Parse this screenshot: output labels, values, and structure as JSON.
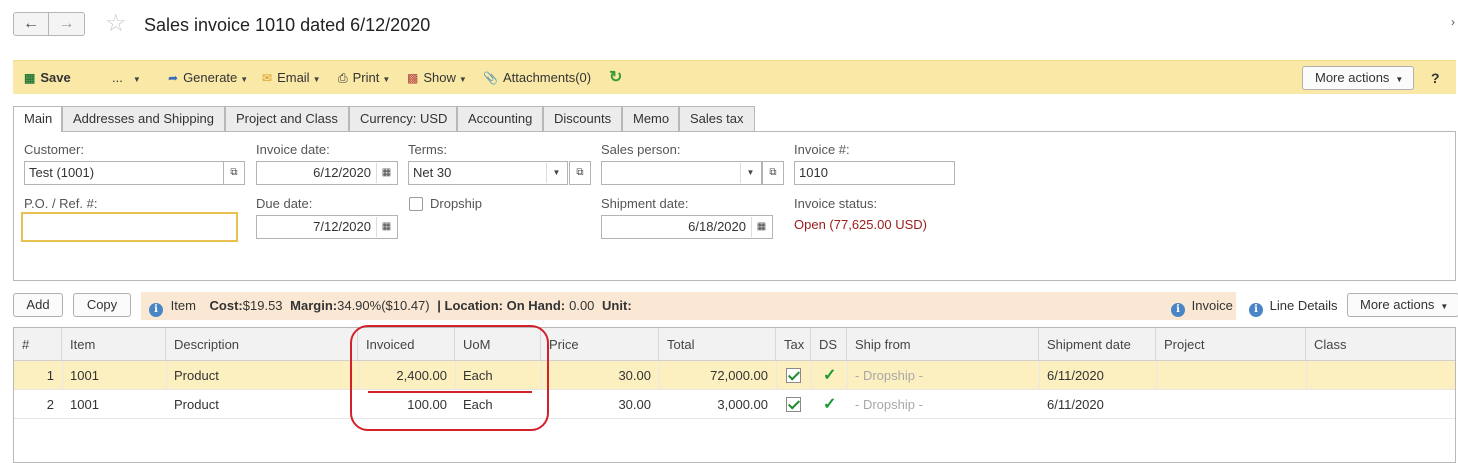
{
  "header": {
    "back_icon": "arrow-left-icon",
    "forward_icon": "arrow-right-icon",
    "favorite_icon": "star-icon",
    "title": "Sales invoice 1010 dated 6/12/2020"
  },
  "toolbar": {
    "save": "Save",
    "more_dots": "...",
    "generate": "Generate",
    "email": "Email",
    "print": "Print",
    "show": "Show",
    "attachments": "Attachments(0)",
    "more_actions": "More actions",
    "help": "?"
  },
  "tabs": [
    {
      "label": "Main"
    },
    {
      "label": "Addresses and Shipping"
    },
    {
      "label": "Project and Class"
    },
    {
      "label": "Currency: USD"
    },
    {
      "label": "Accounting"
    },
    {
      "label": "Discounts"
    },
    {
      "label": "Memo"
    },
    {
      "label": "Sales tax"
    }
  ],
  "form": {
    "customer_label": "Customer:",
    "customer_value": "Test (1001)",
    "po_label": "P.O. / Ref. #:",
    "po_value": "",
    "invoice_date_label": "Invoice date:",
    "invoice_date_value": "6/12/2020",
    "due_date_label": "Due date:",
    "due_date_value": "7/12/2020",
    "terms_label": "Terms:",
    "terms_value": "Net 30",
    "dropship_label": "Dropship",
    "sales_person_label": "Sales person:",
    "sales_person_value": "",
    "shipment_date_label": "Shipment date:",
    "shipment_date_value": "6/18/2020",
    "invoice_num_label": "Invoice #:",
    "invoice_num_value": "1010",
    "invoice_status_label": "Invoice status:",
    "invoice_status_value": "Open (77,625.00 USD)"
  },
  "lines_toolbar": {
    "add": "Add",
    "copy": "Copy",
    "info_item": "Item",
    "cost_label": "Cost:",
    "cost_value": "$19.53",
    "margin_label": "Margin:",
    "margin_value": "34.90%($10.47)",
    "location_text": "| Location: On Hand:",
    "on_hand_value": "0.00",
    "unit_label": "Unit:",
    "invoice_link": "Invoice",
    "line_details": "Line Details",
    "more_actions": "More actions"
  },
  "table": {
    "columns": [
      "#",
      "Item",
      "Description",
      "Invoiced",
      "UoM",
      "Price",
      "Total",
      "Tax",
      "DS",
      "Ship from",
      "Shipment date",
      "Project",
      "Class"
    ],
    "rows": [
      {
        "num": "1",
        "item": "1001",
        "description": "Product",
        "invoiced": "2,400.00",
        "uom": "Each",
        "price": "30.00",
        "total": "72,000.00",
        "tax": true,
        "ds": true,
        "ship_from": "- Dropship -",
        "shipment_date": "6/11/2020",
        "project": "",
        "class": ""
      },
      {
        "num": "2",
        "item": "1001",
        "description": "Product",
        "invoiced": "100.00",
        "uom": "Each",
        "price": "30.00",
        "total": "3,000.00",
        "tax": true,
        "ds": true,
        "ship_from": "- Dropship -",
        "shipment_date": "6/11/2020",
        "project": "",
        "class": ""
      }
    ]
  },
  "colors": {
    "toolbar_bg": "#fae9a6",
    "selected_row": "#fdf0c0",
    "info_bar": "#fae8d4",
    "status_open": "#9b1b1b",
    "annotation": "#d4202a"
  }
}
